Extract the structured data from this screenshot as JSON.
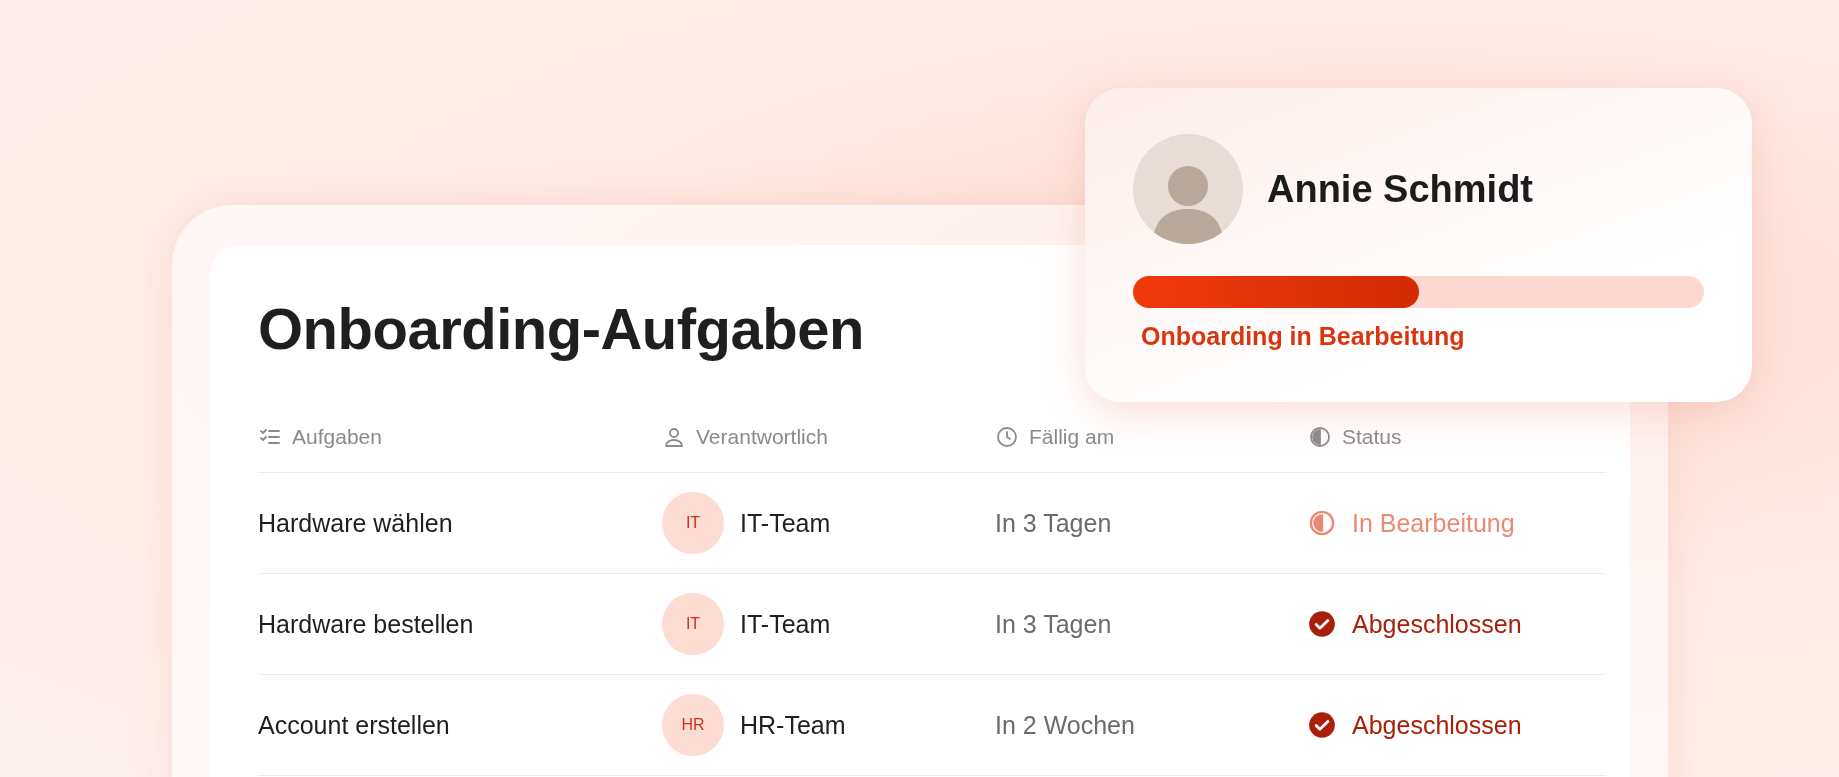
{
  "title": "Onboarding-Aufgaben",
  "columns": [
    "Aufgaben",
    "Verantwortlich",
    "Fällig am",
    "Status"
  ],
  "rows": [
    {
      "task": "Hardware wählen",
      "owner_initials": "IT",
      "owner": "IT-Team",
      "due": "In 3 Tagen",
      "status": {
        "kind": "in_progress",
        "label": "In Bearbeitung"
      }
    },
    {
      "task": "Hardware bestellen",
      "owner_initials": "IT",
      "owner": "IT-Team",
      "due": "In 3 Tagen",
      "status": {
        "kind": "done",
        "label": "Abgeschlossen"
      }
    },
    {
      "task": "Account erstellen",
      "owner_initials": "HR",
      "owner": "HR-Team",
      "due": "In 2 Wochen",
      "status": {
        "kind": "done",
        "label": "Abgeschlossen"
      }
    }
  ],
  "profile": {
    "name": "Annie Schmidt",
    "level": 0.5,
    "status": "Onboarding in Bearbeitung"
  }
}
